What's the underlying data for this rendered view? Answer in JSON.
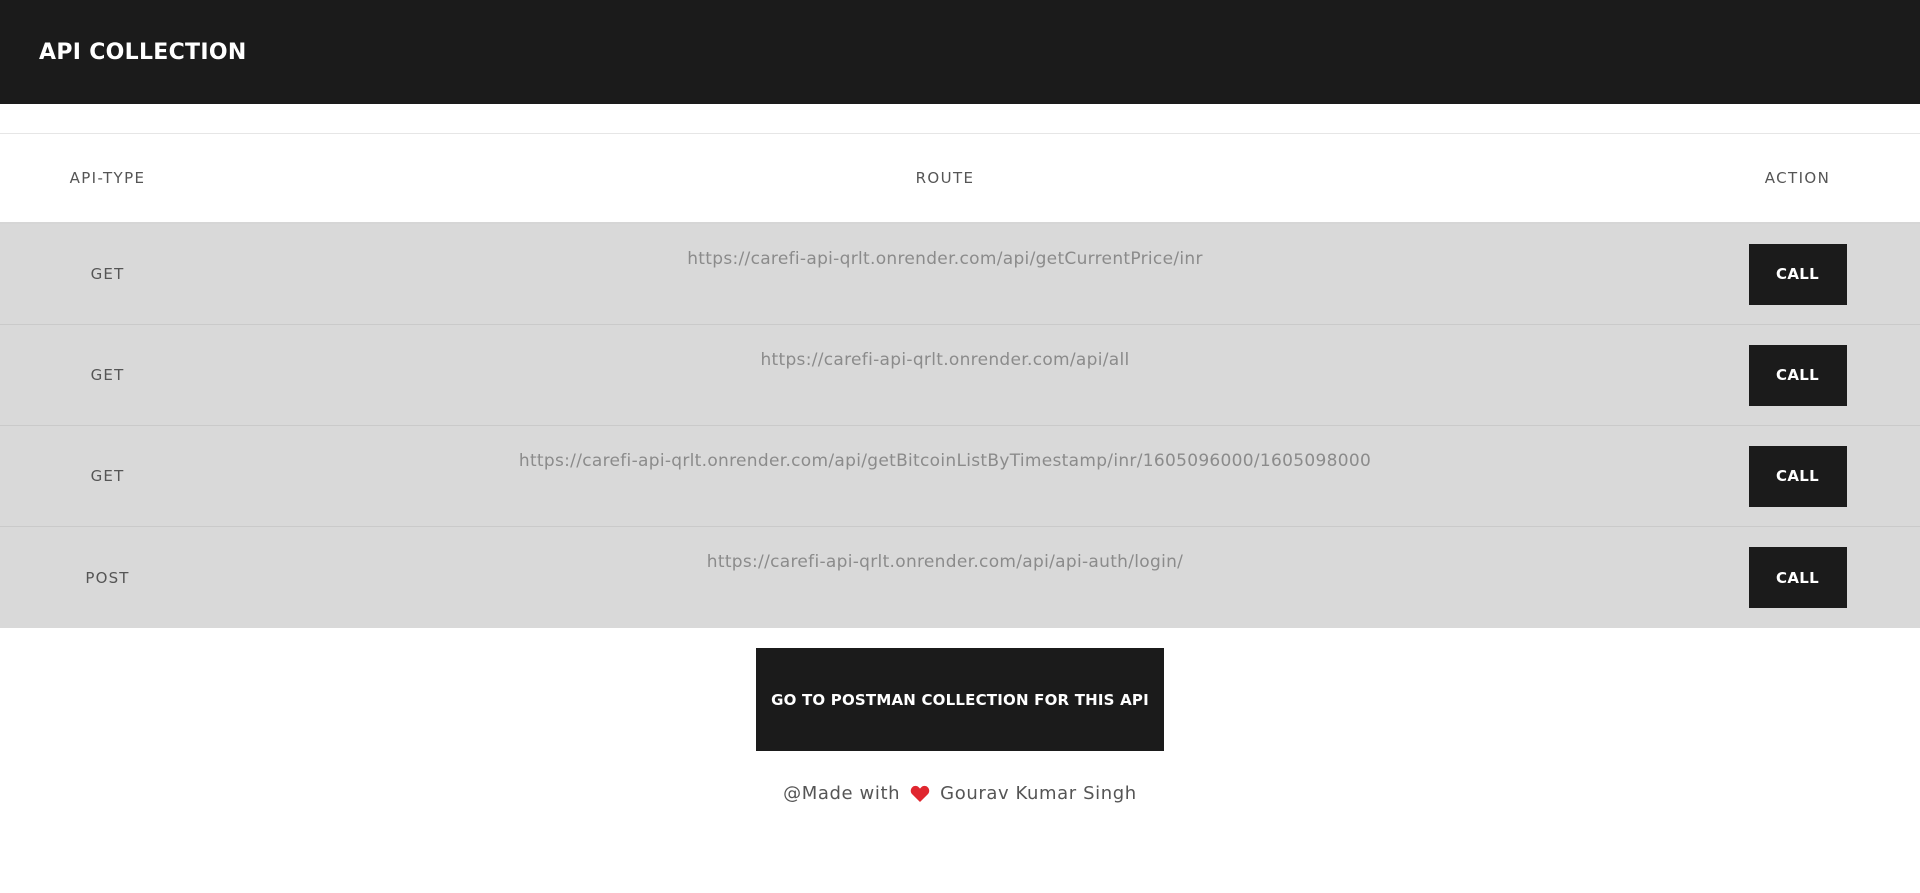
{
  "header": {
    "title": "API COLLECTION"
  },
  "table": {
    "columns": [
      "API-TYPE",
      "ROUTE",
      "ACTION"
    ],
    "rows": [
      {
        "type": "GET",
        "route": "https://carefi-api-qrlt.onrender.com/api/getCurrentPrice/inr",
        "action": "CALL"
      },
      {
        "type": "GET",
        "route": "https://carefi-api-qrlt.onrender.com/api/all",
        "action": "CALL"
      },
      {
        "type": "GET",
        "route": "https://carefi-api-qrlt.onrender.com/api/getBitcoinListByTimestamp/inr/1605096000/1605098000",
        "action": "CALL"
      },
      {
        "type": "POST",
        "route": "https://carefi-api-qrlt.onrender.com/api/api-auth/login/",
        "action": "CALL"
      }
    ]
  },
  "cta": {
    "label": "GO TO POSTMAN COLLECTION FOR THIS API"
  },
  "footer": {
    "prefix": "@Made with",
    "author": "Gourav Kumar Singh",
    "icon": "heart-icon"
  },
  "colors": {
    "dark": "#1b1b1b",
    "row_bg": "#d9d9d9",
    "heart": "#e0262f"
  }
}
